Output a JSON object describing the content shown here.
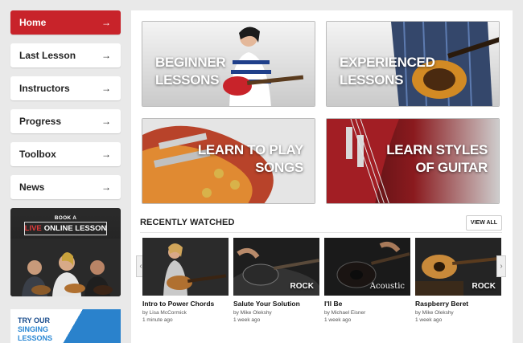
{
  "sidebar": {
    "items": [
      {
        "label": "Home",
        "arrow": "→",
        "active": true
      },
      {
        "label": "Last Lesson",
        "arrow": "→"
      },
      {
        "label": "Instructors",
        "arrow": "→"
      },
      {
        "label": "Progress",
        "arrow": "→"
      },
      {
        "label": "Toolbox",
        "arrow": "→"
      },
      {
        "label": "News",
        "arrow": "→"
      }
    ],
    "promo_live": {
      "book": "BOOK A",
      "live": "LIVE",
      "online": "ONLINE LESSON"
    },
    "promo_singing": {
      "line1": "TRY OUR",
      "line2": "SINGING",
      "line3": "LESSONS"
    }
  },
  "tiles": [
    {
      "line1": "BEGINNER",
      "line2": "LESSONS"
    },
    {
      "line1": "EXPERIENCED",
      "line2": "LESSONS"
    },
    {
      "line1": "LEARN TO PLAY",
      "line2": "SONGS"
    },
    {
      "line1": "LEARN STYLES",
      "line2": "OF GUITAR"
    }
  ],
  "recent": {
    "title": "RECENTLY WATCHED",
    "view_all": "VIEW ALL",
    "prev_icon": "‹",
    "next_icon": "›",
    "videos": [
      {
        "title": "Intro to Power Chords",
        "author": "by Lisa McCormick",
        "time": "1 minute ago",
        "tag": ""
      },
      {
        "title": "Salute Your Solution",
        "author": "by Mike Olekshy",
        "time": "1 week ago",
        "tag": "ROCK"
      },
      {
        "title": "I'll Be",
        "author": "by Michael Eisner",
        "time": "1 week ago",
        "tag": "Acoustic"
      },
      {
        "title": "Raspberry Beret",
        "author": "by Mike Olekshy",
        "time": "1 week ago",
        "tag": "ROCK"
      }
    ]
  },
  "colors": {
    "accent": "#c8232a",
    "panel": "#ffffff",
    "background": "#e9e9e9"
  }
}
